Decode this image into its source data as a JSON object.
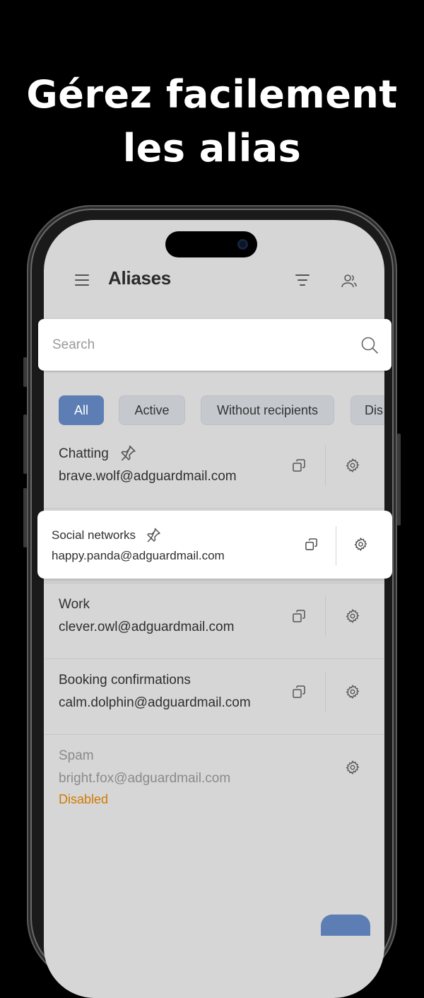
{
  "headline": {
    "line1": "Gérez facilement",
    "line2": "les alias"
  },
  "header": {
    "title": "Aliases"
  },
  "search": {
    "placeholder": "Search"
  },
  "filters": [
    {
      "label": "All",
      "active": true
    },
    {
      "label": "Active",
      "active": false
    },
    {
      "label": "Without recipients",
      "active": false
    },
    {
      "label": "Dis",
      "active": false
    }
  ],
  "aliases": [
    {
      "name": "Chatting",
      "email": "brave.wolf@adguardmail.com",
      "pinned": true
    },
    {
      "name": "Social networks",
      "email": "happy.panda@adguardmail.com",
      "pinned": true,
      "highlighted": true
    },
    {
      "name": "Work",
      "email": "clever.owl@adguardmail.com",
      "pinned": false
    },
    {
      "name": "Booking confirmations",
      "email": "calm.dolphin@adguardmail.com",
      "pinned": false
    },
    {
      "name": "Spam",
      "email": "bright.fox@adguardmail.com",
      "status": "Disabled",
      "disabled": true
    }
  ],
  "colors": {
    "accent": "#5d7eb4",
    "disabled_status": "#d07a00",
    "screen_bg": "#d6d6d6"
  }
}
